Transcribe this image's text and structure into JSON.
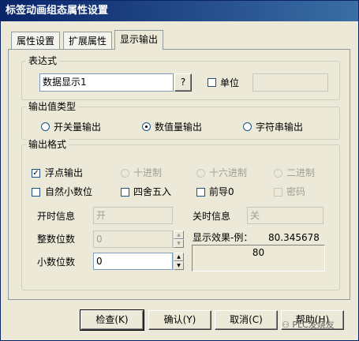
{
  "window": {
    "title": "标签动画组态属性设置"
  },
  "tabs": [
    {
      "label": "属性设置",
      "active": false
    },
    {
      "label": "扩展属性",
      "active": false
    },
    {
      "label": "显示输出",
      "active": true
    }
  ],
  "expression_group": {
    "title": "表达式",
    "expression_value": "数据显示1",
    "browse_label": "?",
    "unit_checkbox_label": "单位",
    "unit_checked": false,
    "unit_value": ""
  },
  "output_type_group": {
    "title": "输出值类型",
    "options": [
      {
        "label": "开关量输出",
        "selected": false
      },
      {
        "label": "数值量输出",
        "selected": true
      },
      {
        "label": "字符串输出",
        "selected": false
      }
    ]
  },
  "output_format_group": {
    "title": "输出格式",
    "row1": [
      {
        "label": "浮点输出",
        "control": "checkbox",
        "checked": true,
        "enabled": true
      },
      {
        "label": "十进制",
        "control": "radio",
        "checked": false,
        "enabled": false
      },
      {
        "label": "十六进制",
        "control": "radio",
        "checked": false,
        "enabled": false
      },
      {
        "label": "二进制",
        "control": "radio",
        "checked": false,
        "enabled": false
      }
    ],
    "row2": [
      {
        "label": "自然小数位",
        "checked": false,
        "enabled": true
      },
      {
        "label": "四舍五入",
        "checked": false,
        "enabled": true
      },
      {
        "label": "前导0",
        "checked": false,
        "enabled": true
      },
      {
        "label": "密码",
        "checked": false,
        "enabled": false
      }
    ],
    "on_label": "开时信息",
    "on_value": "开",
    "off_label": "关时信息",
    "off_value": "关",
    "integer_digits_label": "整数位数",
    "integer_digits_value": "0",
    "preview_label": "显示效果-例：",
    "preview_value": "80.345678",
    "decimal_digits_label": "小数位数",
    "decimal_digits_value": "0",
    "preview_result": "80"
  },
  "buttons": {
    "check": "检查(K)",
    "ok": "确认(Y)",
    "cancel": "取消(C)",
    "help": "帮助(H)"
  },
  "watermark": "PLC发烧友"
}
